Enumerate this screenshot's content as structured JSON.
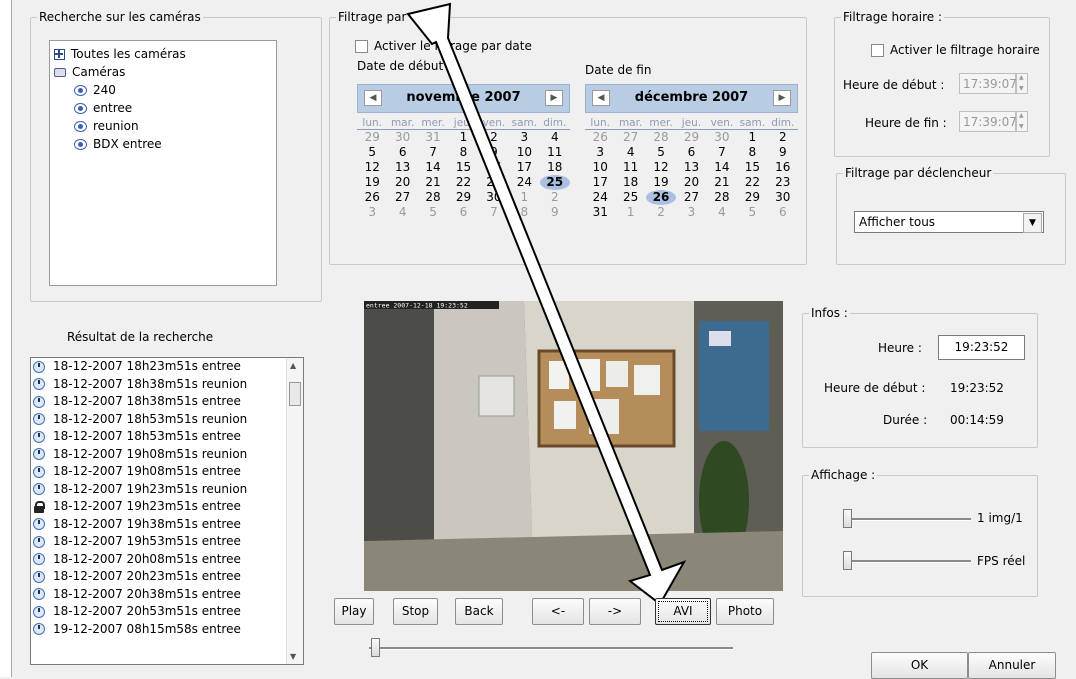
{
  "camera_search": {
    "legend": "Recherche sur les caméras",
    "all_cameras": "Toutes les caméras",
    "cameras_node": "Caméras",
    "cameras": [
      "240",
      "entree",
      "reunion",
      "BDX entree"
    ]
  },
  "date_filter": {
    "legend": "Filtrage par date :",
    "checkbox_label": "Activer le filtrage par date",
    "start_label": "Date de début",
    "end_label": "Date de fin",
    "start_calendar": {
      "month": "novembre 2007",
      "dows": [
        "lun.",
        "mar.",
        "mer.",
        "jeu.",
        "ven.",
        "sam.",
        "dim."
      ],
      "days": [
        "29",
        "30",
        "31",
        "1",
        "2",
        "3",
        "4",
        "5",
        "6",
        "7",
        "8",
        "9",
        "10",
        "11",
        "12",
        "13",
        "14",
        "15",
        "16",
        "17",
        "18",
        "19",
        "20",
        "21",
        "22",
        "23",
        "24",
        "25",
        "26",
        "27",
        "28",
        "29",
        "30",
        "1",
        "2",
        "3",
        "4",
        "5",
        "6",
        "7",
        "8",
        "9"
      ],
      "highlight": "25"
    },
    "end_calendar": {
      "month": "décembre 2007",
      "dows": [
        "lun.",
        "mar.",
        "mer.",
        "jeu.",
        "ven.",
        "sam.",
        "dim."
      ],
      "days": [
        "26",
        "27",
        "28",
        "29",
        "30",
        "1",
        "2",
        "3",
        "4",
        "5",
        "6",
        "7",
        "8",
        "9",
        "10",
        "11",
        "12",
        "13",
        "14",
        "15",
        "16",
        "17",
        "18",
        "19",
        "20",
        "21",
        "22",
        "23",
        "24",
        "25",
        "26",
        "27",
        "28",
        "29",
        "30",
        "31",
        "1",
        "2",
        "3",
        "4",
        "5",
        "6"
      ],
      "highlight": "26"
    }
  },
  "time_filter": {
    "legend": "Filtrage horaire :",
    "checkbox_label": "Activer le filtrage horaire",
    "start_label": "Heure de début :",
    "start_value": "17:39:07",
    "end_label": "Heure de fin :",
    "end_value": "17:39:07"
  },
  "trigger_filter": {
    "legend": "Filtrage par déclencheur",
    "selected": "Afficher tous"
  },
  "results": {
    "title": "Résultat de la recherche",
    "items": [
      {
        "text": "18-12-2007 18h23m51s entree",
        "icon": "clock-icon"
      },
      {
        "text": "18-12-2007 18h38m51s reunion",
        "icon": "clock-icon"
      },
      {
        "text": "18-12-2007 18h38m51s entree",
        "icon": "clock-icon"
      },
      {
        "text": "18-12-2007 18h53m51s reunion",
        "icon": "clock-icon"
      },
      {
        "text": "18-12-2007 18h53m51s entree",
        "icon": "clock-icon"
      },
      {
        "text": "18-12-2007 19h08m51s reunion",
        "icon": "clock-icon"
      },
      {
        "text": "18-12-2007 19h08m51s entree",
        "icon": "clock-icon"
      },
      {
        "text": "18-12-2007 19h23m51s reunion",
        "icon": "clock-icon"
      },
      {
        "text": "18-12-2007 19h23m51s entree",
        "icon": "lock-icon"
      },
      {
        "text": "18-12-2007 19h38m51s entree",
        "icon": "clock-icon"
      },
      {
        "text": "18-12-2007 19h53m51s entree",
        "icon": "clock-icon"
      },
      {
        "text": "18-12-2007 20h08m51s entree",
        "icon": "clock-icon"
      },
      {
        "text": "18-12-2007 20h23m51s entree",
        "icon": "clock-icon"
      },
      {
        "text": "18-12-2007 20h38m51s entree",
        "icon": "clock-icon"
      },
      {
        "text": "18-12-2007 20h53m51s entree",
        "icon": "clock-icon"
      },
      {
        "text": "19-12-2007 08h15m58s entree",
        "icon": "clock-icon"
      }
    ]
  },
  "video": {
    "timestamp": "entree 2007-12-18 19:23:52"
  },
  "controls": {
    "play": "Play",
    "stop": "Stop",
    "back": "Back",
    "prev": "<-",
    "next": "->",
    "avi": "AVI",
    "photo": "Photo",
    "position": 0
  },
  "info": {
    "legend": "Infos :",
    "time_label": "Heure :",
    "time_value": "19:23:52",
    "start_label": "Heure de début :",
    "start_value": "19:23:52",
    "duration_label": "Durée :",
    "duration_value": "00:14:59"
  },
  "display": {
    "legend": "Affichage :",
    "rate_label": "1 img/1",
    "fps_label": "FPS réel"
  },
  "dialog": {
    "ok": "OK",
    "cancel": "Annuler"
  },
  "colors": {
    "calendar_header": "#b8cde4",
    "highlight": "#a9c0e2"
  }
}
